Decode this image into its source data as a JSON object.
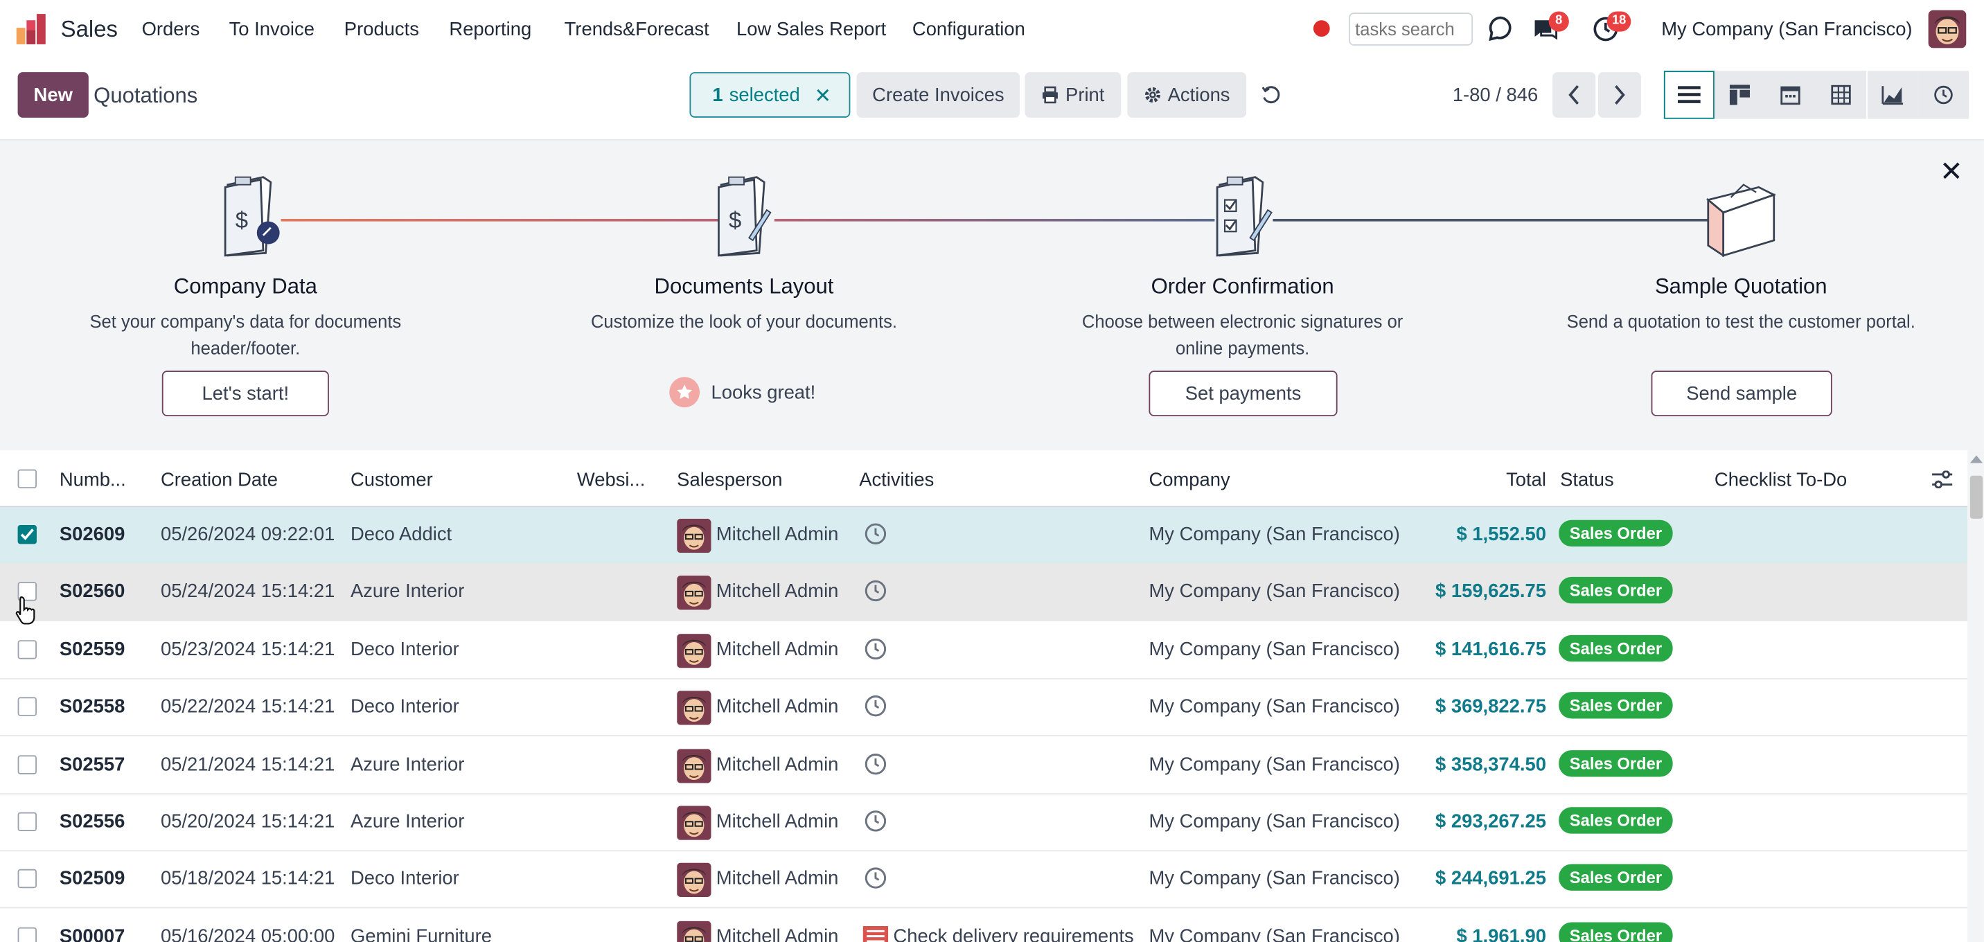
{
  "navbar": {
    "app_name": "Sales",
    "menu": [
      "Orders",
      "To Invoice",
      "Products",
      "Reporting",
      "Trends&Forecast",
      "Low Sales Report",
      "Configuration"
    ],
    "search_placeholder": "tasks search",
    "messages_badge": "8",
    "activities_badge": "18",
    "company": "My Company (San Francisco)"
  },
  "control_panel": {
    "new_label": "New",
    "breadcrumb": "Quotations",
    "selected_count": "1",
    "selected_label": "selected",
    "create_invoices_label": "Create Invoices",
    "print_label": "Print",
    "actions_label": "Actions",
    "pager_text": "1-80 / 846"
  },
  "onboarding": {
    "steps": [
      {
        "title": "Company Data",
        "desc": "Set your company's data for documents header/footer.",
        "button": "Let's start!"
      },
      {
        "title": "Documents Layout",
        "desc": "Customize the look of your documents.",
        "done_label": "Looks great!"
      },
      {
        "title": "Order Confirmation",
        "desc": "Choose between electronic signatures or online payments.",
        "button": "Set payments"
      },
      {
        "title": "Sample Quotation",
        "desc": "Send a quotation to test the customer portal.",
        "button": "Send sample"
      }
    ]
  },
  "table": {
    "columns": [
      "Numb...",
      "Creation Date",
      "Customer",
      "Websi...",
      "Salesperson",
      "Activities",
      "Company",
      "Total",
      "Status",
      "Checklist To-Do"
    ],
    "rows": [
      {
        "number": "S02609",
        "date": "05/26/2024 09:22:01",
        "customer": "Deco Addict",
        "salesperson": "Mitchell Admin",
        "activity": "",
        "company": "My Company (San Francisco)",
        "total": "$ 1,552.50",
        "status": "Sales Order",
        "selected": true
      },
      {
        "number": "S02560",
        "date": "05/24/2024 15:14:21",
        "customer": "Azure Interior",
        "salesperson": "Mitchell Admin",
        "activity": "",
        "company": "My Company (San Francisco)",
        "total": "$ 159,625.75",
        "status": "Sales Order",
        "selected": false
      },
      {
        "number": "S02559",
        "date": "05/23/2024 15:14:21",
        "customer": "Deco Interior",
        "salesperson": "Mitchell Admin",
        "activity": "",
        "company": "My Company (San Francisco)",
        "total": "$ 141,616.75",
        "status": "Sales Order",
        "selected": false
      },
      {
        "number": "S02558",
        "date": "05/22/2024 15:14:21",
        "customer": "Deco Interior",
        "salesperson": "Mitchell Admin",
        "activity": "",
        "company": "My Company (San Francisco)",
        "total": "$ 369,822.75",
        "status": "Sales Order",
        "selected": false
      },
      {
        "number": "S02557",
        "date": "05/21/2024 15:14:21",
        "customer": "Azure Interior",
        "salesperson": "Mitchell Admin",
        "activity": "",
        "company": "My Company (San Francisco)",
        "total": "$ 358,374.50",
        "status": "Sales Order",
        "selected": false
      },
      {
        "number": "S02556",
        "date": "05/20/2024 15:14:21",
        "customer": "Azure Interior",
        "salesperson": "Mitchell Admin",
        "activity": "",
        "company": "My Company (San Francisco)",
        "total": "$ 293,267.25",
        "status": "Sales Order",
        "selected": false
      },
      {
        "number": "S02509",
        "date": "05/18/2024 15:14:21",
        "customer": "Deco Interior",
        "salesperson": "Mitchell Admin",
        "activity": "",
        "company": "My Company (San Francisco)",
        "total": "$ 244,691.25",
        "status": "Sales Order",
        "selected": false
      },
      {
        "number": "S00007",
        "date": "05/16/2024 05:00:00",
        "customer": "Gemini Furniture",
        "salesperson": "Mitchell Admin",
        "activity": "Check delivery requirements",
        "company": "My Company (San Francisco)",
        "total": "$ 1,961.90",
        "status": "Sales Order",
        "selected": false
      }
    ]
  },
  "colors": {
    "brand": "#71415f",
    "accent": "#017e84",
    "status_green": "#28a745",
    "badge_red": "#e94141"
  }
}
